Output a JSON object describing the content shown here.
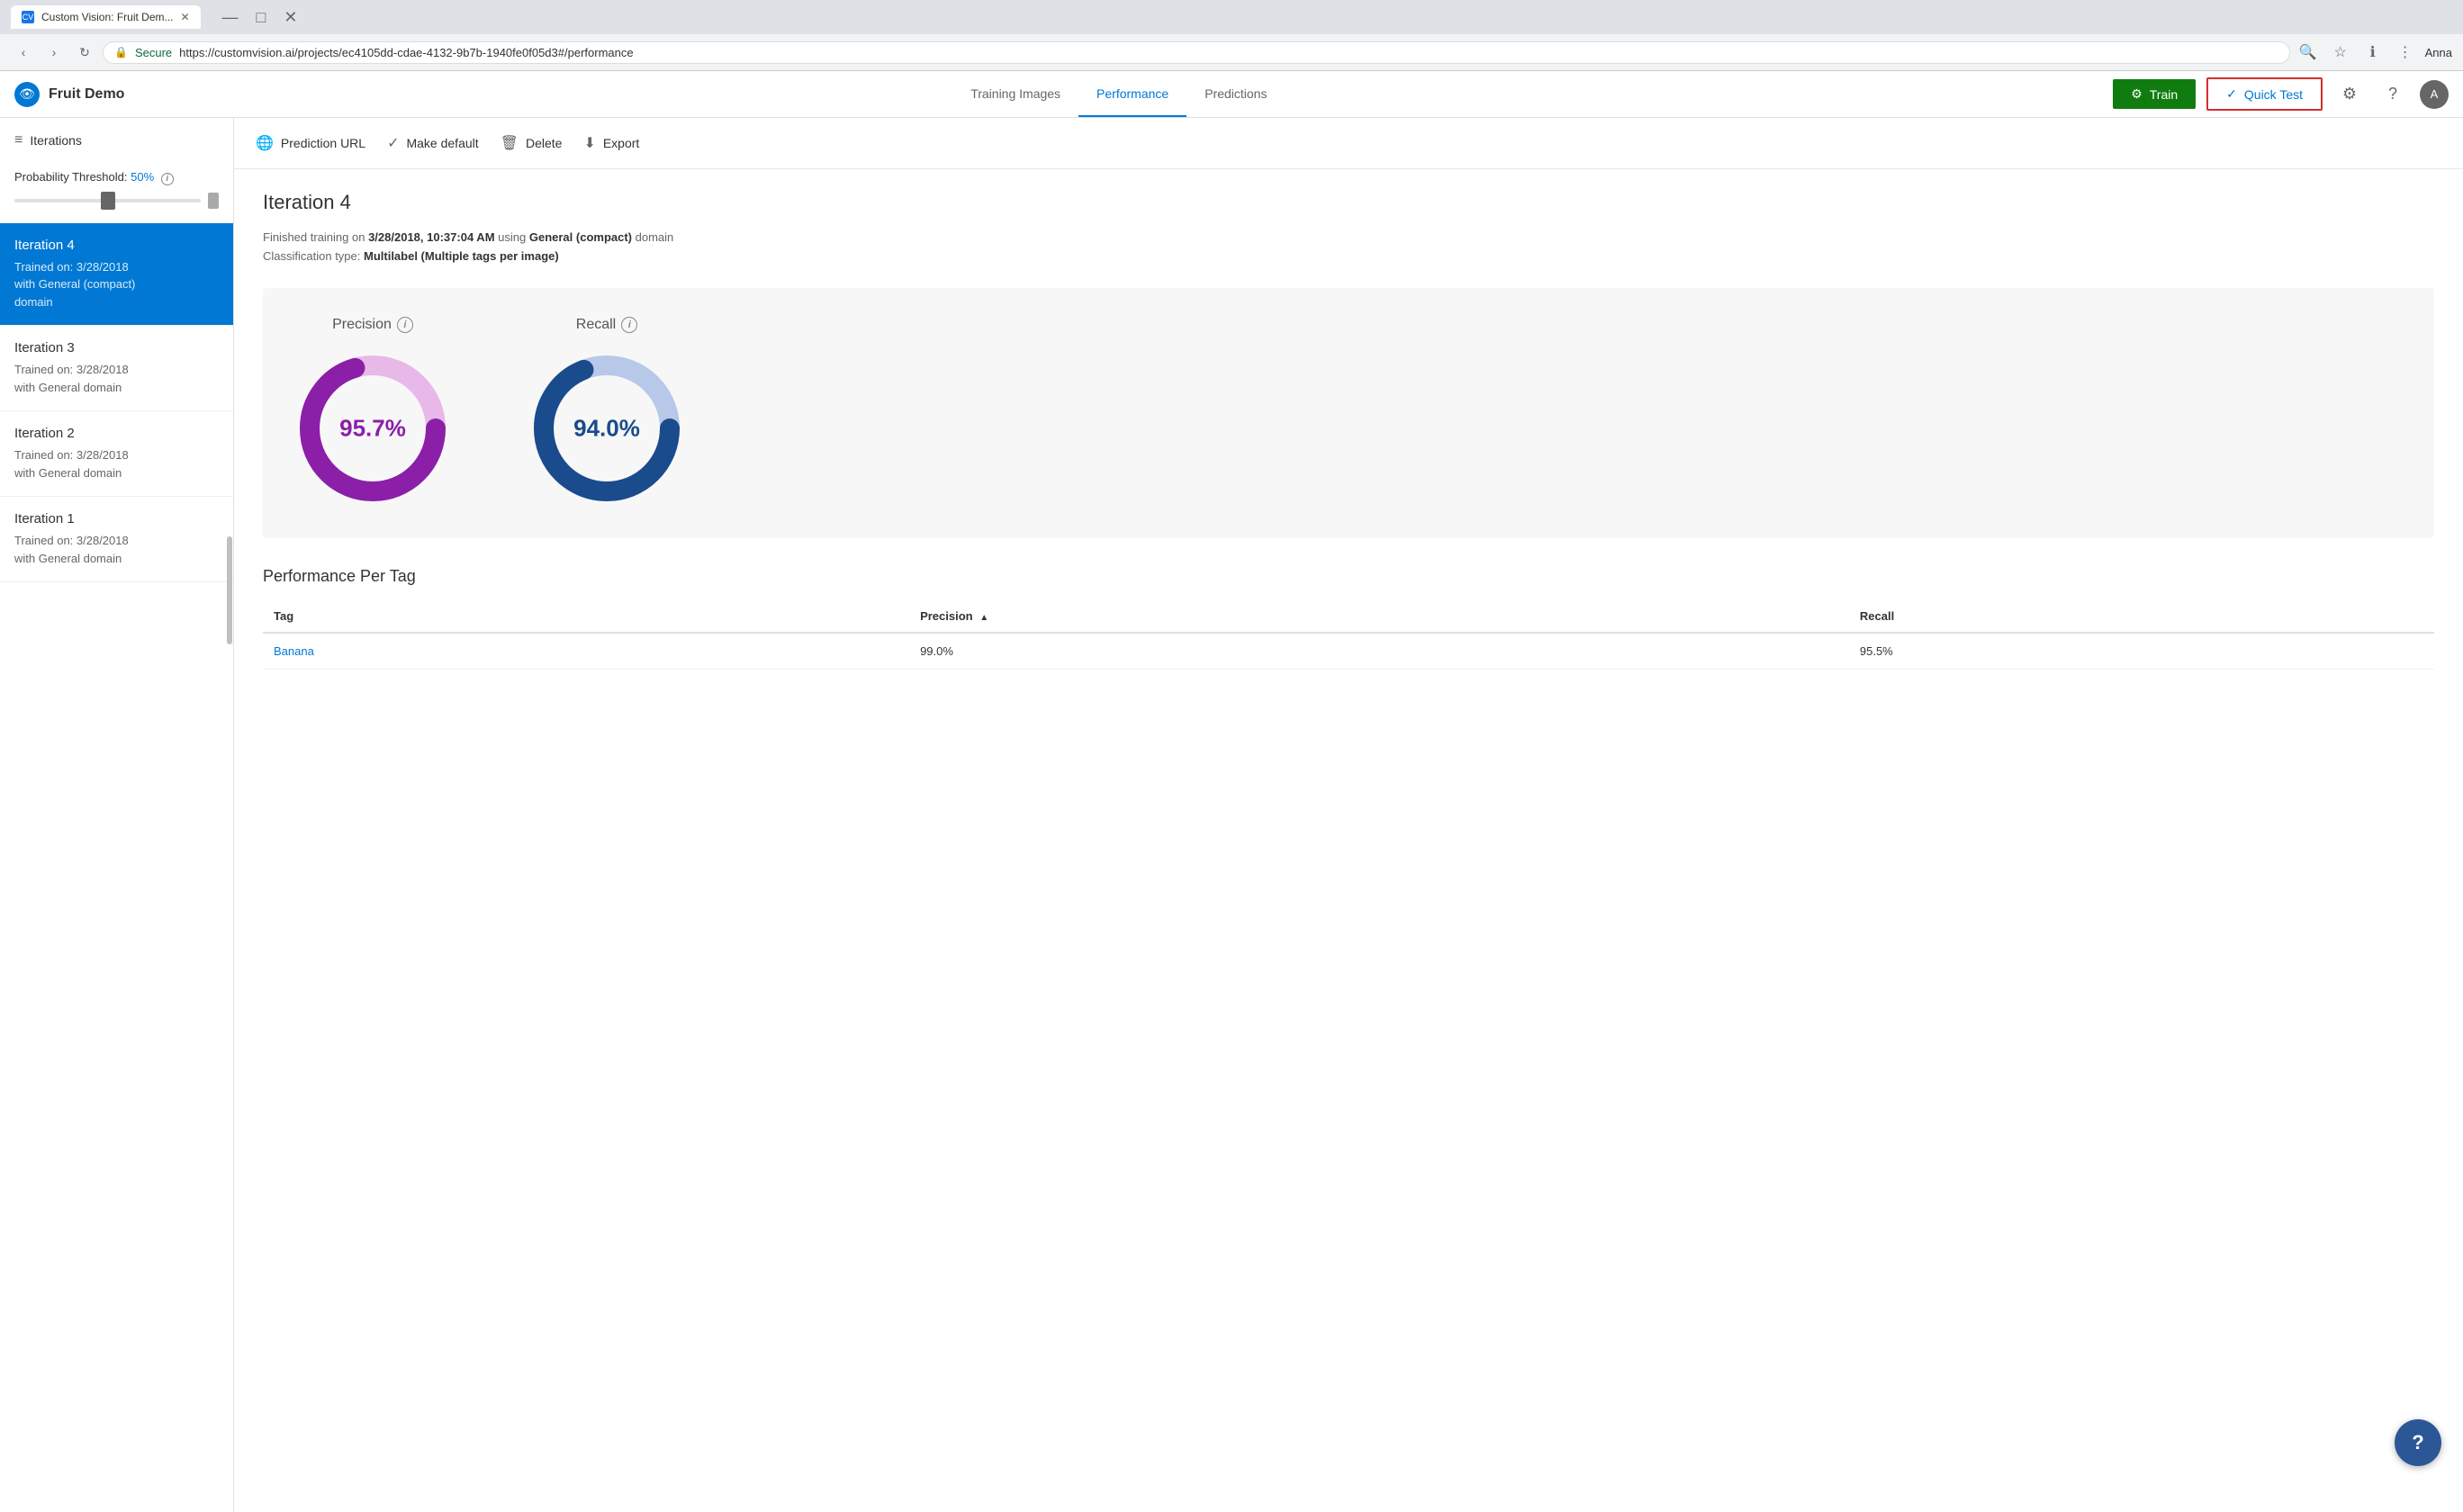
{
  "browser": {
    "tab_title": "Custom Vision: Fruit Dem...",
    "url": "https://customvision.ai/projects/ec4105dd-cdae-4132-9b7b-1940fe0f05d3#/performance",
    "user_name": "Anna"
  },
  "app": {
    "logo_icon": "👁",
    "title": "Fruit Demo",
    "nav": {
      "training_images": "Training Images",
      "performance": "Performance",
      "predictions": "Predictions"
    },
    "train_btn": "Train",
    "quick_test_btn": "Quick Test"
  },
  "toolbar": {
    "prediction_url": "Prediction URL",
    "make_default": "Make default",
    "delete": "Delete",
    "export": "Export"
  },
  "sidebar": {
    "header": "Iterations",
    "probability_label": "Probability Threshold:",
    "probability_value": "50%",
    "iterations": [
      {
        "id": 4,
        "name": "Iteration 4",
        "sub": "Trained on: 3/28/2018\nwith General (compact)\ndomain",
        "active": true
      },
      {
        "id": 3,
        "name": "Iteration 3",
        "sub": "Trained on: 3/28/2018\nwith General domain",
        "active": false
      },
      {
        "id": 2,
        "name": "Iteration 2",
        "sub": "Trained on: 3/28/2018\nwith General domain",
        "active": false
      },
      {
        "id": 1,
        "name": "Iteration 1",
        "sub": "Trained on: 3/28/2018\nwith General domain",
        "active": false
      }
    ]
  },
  "content": {
    "iteration_title": "Iteration 4",
    "training_info": {
      "date_prefix": "Finished training on ",
      "date": "3/28/2018, 10:37:04 AM",
      "date_suffix": " using ",
      "domain": "General (compact)",
      "domain_suffix": " domain",
      "classification_prefix": "Classification type: ",
      "classification": "Multilabel (Multiple tags per image)"
    },
    "precision": {
      "label": "Precision",
      "value": "95.7%",
      "percent": 95.7
    },
    "recall": {
      "label": "Recall",
      "value": "94.0%",
      "percent": 94.0
    },
    "per_tag_title": "Performance Per Tag",
    "table": {
      "headers": [
        "Tag",
        "Precision",
        "Recall"
      ],
      "rows": [
        {
          "tag": "Banana",
          "precision": "99.0%",
          "recall": "95.5%"
        }
      ]
    }
  }
}
